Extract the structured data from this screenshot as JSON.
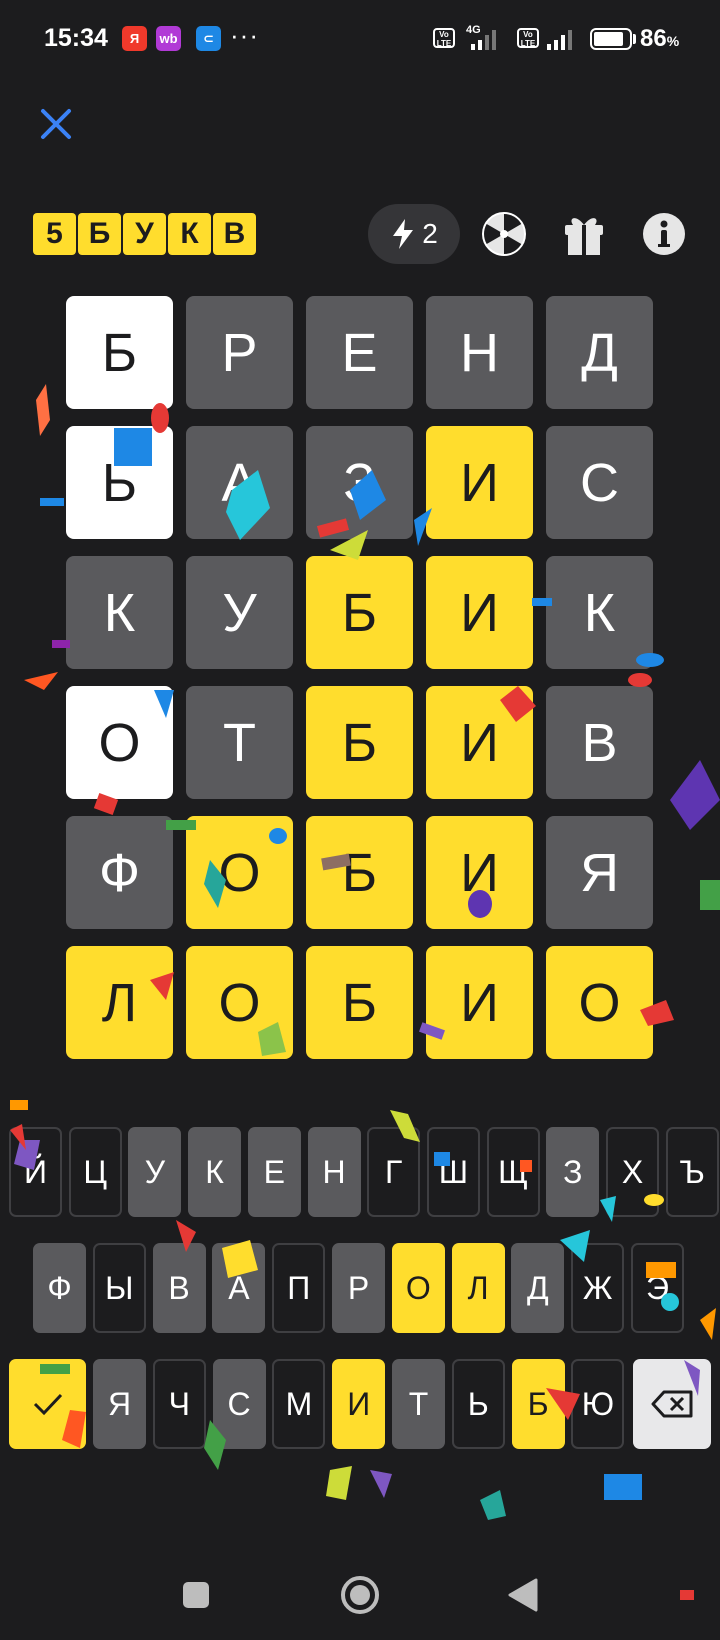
{
  "status_bar": {
    "time": "15:34",
    "apps": [
      {
        "label": "Я",
        "color": "#f0392b"
      },
      {
        "label": "wb",
        "color": "#b13ad6"
      },
      {
        "label": "⊂",
        "color": "#1e88e5"
      }
    ],
    "more": "···",
    "network": "4G",
    "volte": "Vo LTE",
    "battery_percent": 86,
    "battery_value": "86",
    "battery_unit": "%"
  },
  "header": {
    "logo_letters": [
      "5",
      "Б",
      "У",
      "К",
      "В"
    ],
    "hints_count": "2",
    "icons": [
      "close-icon",
      "lightning-icon",
      "wheel-icon",
      "gift-icon",
      "info-icon"
    ]
  },
  "board": {
    "rows": [
      {
        "letters": [
          "Б",
          "Р",
          "Е",
          "Н",
          "Д"
        ],
        "states": [
          "white",
          "gray",
          "gray",
          "gray",
          "gray"
        ]
      },
      {
        "letters": [
          "Ь",
          "А",
          "З",
          "И",
          "С"
        ],
        "states": [
          "white",
          "gray",
          "gray",
          "yellow",
          "gray"
        ]
      },
      {
        "letters": [
          "К",
          "У",
          "Б",
          "И",
          "К"
        ],
        "states": [
          "gray",
          "gray",
          "yellow",
          "yellow",
          "gray"
        ]
      },
      {
        "letters": [
          "О",
          "Т",
          "Б",
          "И",
          "В"
        ],
        "states": [
          "white",
          "gray",
          "yellow",
          "yellow",
          "gray"
        ]
      },
      {
        "letters": [
          "Ф",
          "О",
          "Б",
          "И",
          "Я"
        ],
        "states": [
          "gray",
          "yellow",
          "yellow",
          "yellow",
          "gray"
        ]
      },
      {
        "letters": [
          "Л",
          "О",
          "Б",
          "И",
          "О"
        ],
        "states": [
          "yellow",
          "yellow",
          "yellow",
          "yellow",
          "yellow"
        ]
      }
    ]
  },
  "keyboard": {
    "row1": [
      {
        "k": "Й",
        "s": "dark"
      },
      {
        "k": "Ц",
        "s": "dark"
      },
      {
        "k": "У",
        "s": "gray"
      },
      {
        "k": "К",
        "s": "gray"
      },
      {
        "k": "Е",
        "s": "gray"
      },
      {
        "k": "Н",
        "s": "gray"
      },
      {
        "k": "Г",
        "s": "dark"
      },
      {
        "k": "Ш",
        "s": "dark"
      },
      {
        "k": "Щ",
        "s": "dark"
      },
      {
        "k": "З",
        "s": "gray"
      },
      {
        "k": "Х",
        "s": "dark"
      },
      {
        "k": "Ъ",
        "s": "dark"
      }
    ],
    "row2": [
      {
        "k": "Ф",
        "s": "gray"
      },
      {
        "k": "Ы",
        "s": "dark"
      },
      {
        "k": "В",
        "s": "gray"
      },
      {
        "k": "А",
        "s": "gray"
      },
      {
        "k": "П",
        "s": "dark"
      },
      {
        "k": "Р",
        "s": "gray"
      },
      {
        "k": "О",
        "s": "yellow"
      },
      {
        "k": "Л",
        "s": "yellow"
      },
      {
        "k": "Д",
        "s": "gray"
      },
      {
        "k": "Ж",
        "s": "dark"
      },
      {
        "k": "Э",
        "s": "dark"
      }
    ],
    "row3": [
      {
        "k": "Я",
        "s": "gray"
      },
      {
        "k": "Ч",
        "s": "dark"
      },
      {
        "k": "С",
        "s": "gray"
      },
      {
        "k": "М",
        "s": "dark"
      },
      {
        "k": "И",
        "s": "yellow"
      },
      {
        "k": "Т",
        "s": "gray"
      },
      {
        "k": "Ь",
        "s": "dark"
      },
      {
        "k": "Б",
        "s": "yellow"
      },
      {
        "k": "Ю",
        "s": "dark"
      }
    ]
  },
  "nav": {
    "icons": [
      "recent-apps-icon",
      "home-icon",
      "back-icon"
    ]
  },
  "colors": {
    "background": "#1c1c1e",
    "tile_gray": "#5a5a5d",
    "tile_yellow": "#ffdd2d",
    "tile_white": "#ffffff",
    "accent_blue": "#3b82f6"
  }
}
